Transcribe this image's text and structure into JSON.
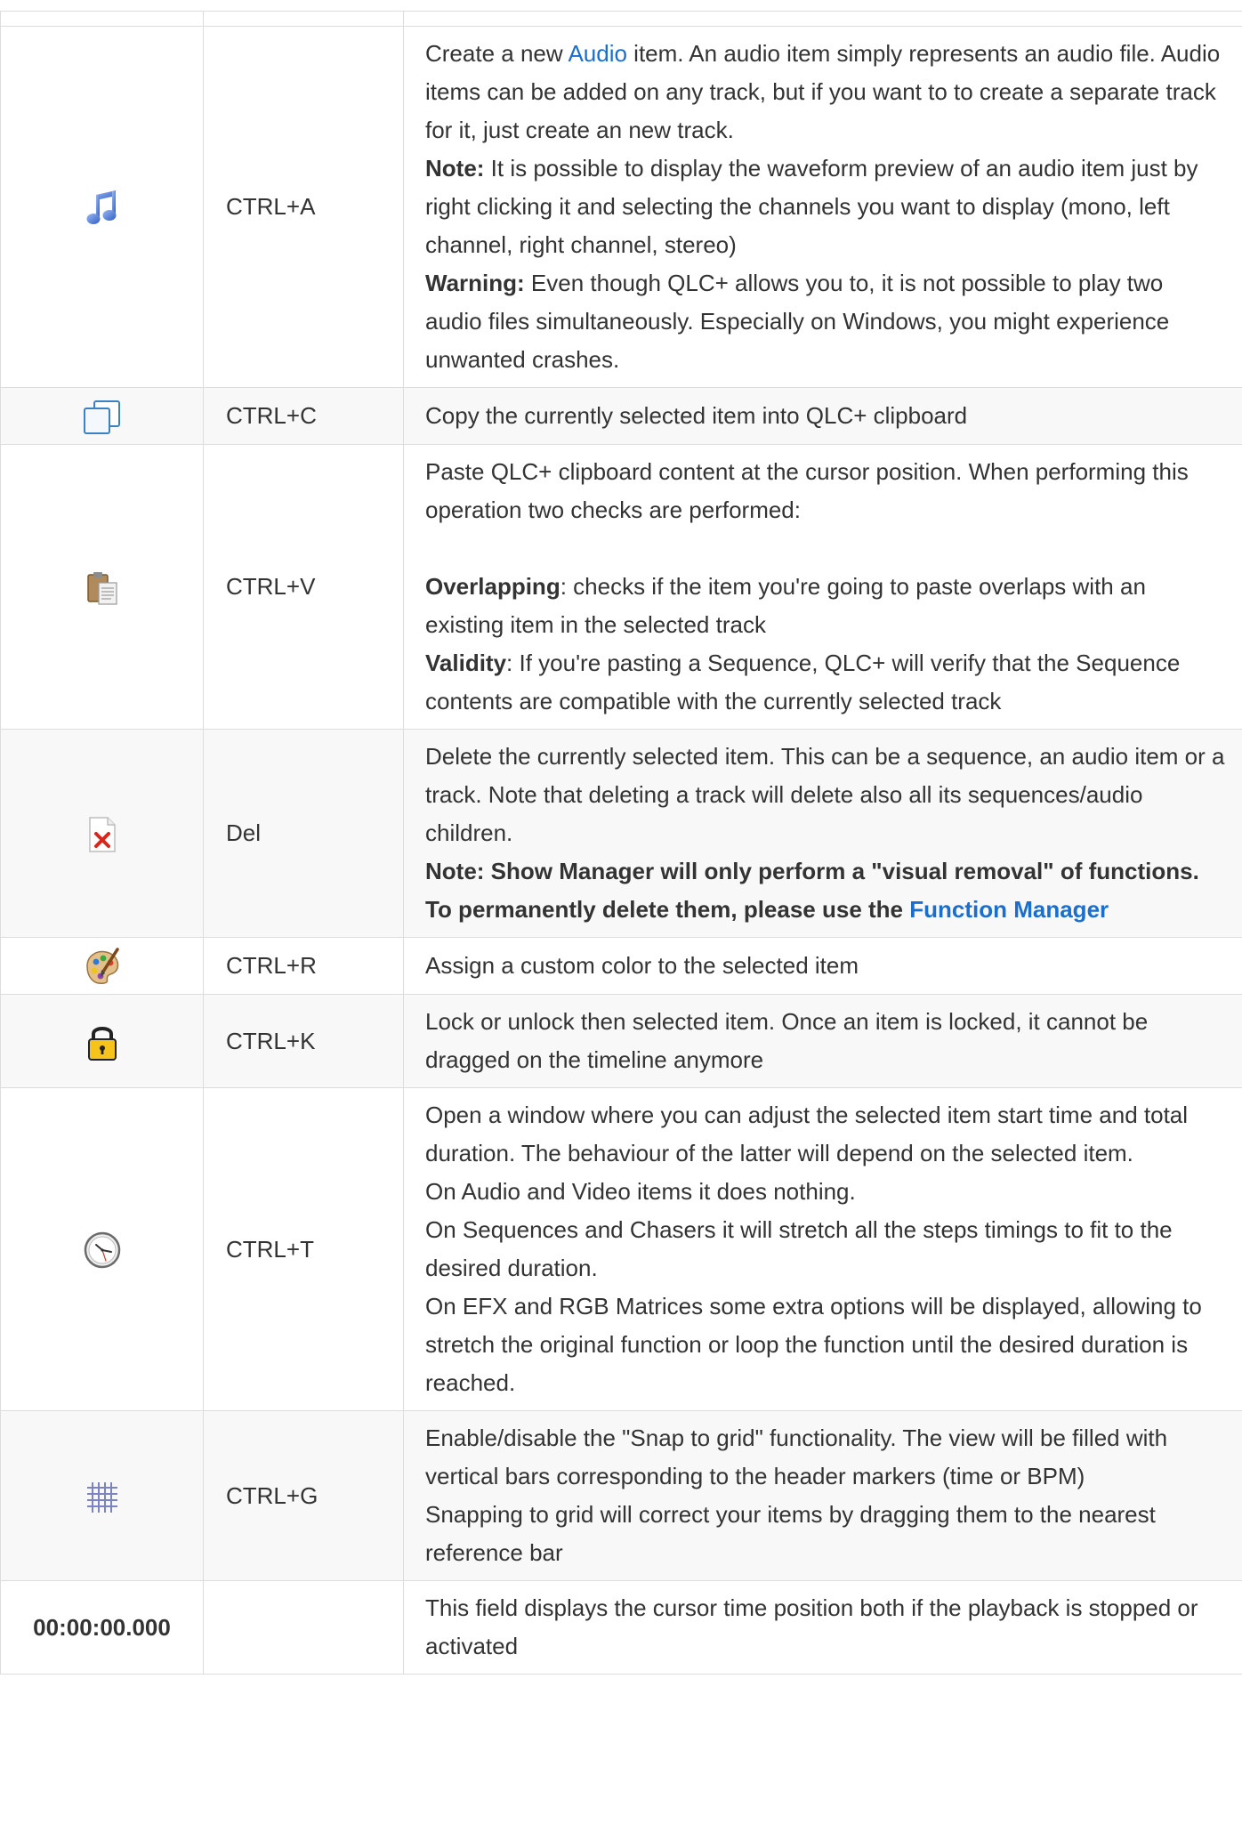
{
  "rows": [
    {
      "icon": "",
      "key": "",
      "desc": ""
    },
    {
      "icon": "music-note-icon",
      "key": "CTRL+A",
      "desc": {
        "p1_pre": "Create a new ",
        "p1_link": "Audio",
        "p1_post": " item. An audio item simply represents an audio file. Audio items can be added on any track, but if you want to to create a separate track for it, just create an new track.",
        "note_label": "Note:",
        "note_text": " It is possible to display the waveform preview of an audio item just by right clicking it and selecting the channels you want to display (mono, left channel, right channel, stereo)",
        "warning_label": "Warning:",
        "warning_text": " Even though QLC+ allows you to, it is not possible to play two audio files simultaneously. Especially on Windows, you might experience unwanted crashes."
      }
    },
    {
      "icon": "copy-icon",
      "key": "CTRL+C",
      "desc": "Copy the currently selected item into QLC+ clipboard"
    },
    {
      "icon": "paste-icon",
      "key": "CTRL+V",
      "desc": {
        "intro": "Paste QLC+ clipboard content at the cursor position. When performing this operation two checks are performed:",
        "overlap_label": "Overlapping",
        "overlap_text": ": checks if the item you're going to paste overlaps with an existing item in the selected track",
        "validity_label": "Validity",
        "validity_text": ": If you're pasting a Sequence, QLC+ will verify that the Sequence contents are compatible with the currently selected track"
      }
    },
    {
      "icon": "delete-icon",
      "key": "Del",
      "desc": {
        "text": "Delete the currently selected item. This can be a sequence, an audio item or a track. Note that deleting a track will delete also all its sequences/audio children.",
        "note_bold": "Note: Show Manager will only perform a \"visual removal\" of functions. To permanently delete them, please use the ",
        "link": "Function Manager"
      }
    },
    {
      "icon": "color-palette-icon",
      "key": "CTRL+R",
      "desc": "Assign a custom color to the selected item"
    },
    {
      "icon": "lock-icon",
      "key": "CTRL+K",
      "desc": "Lock or unlock then selected item. Once an item is locked, it cannot be dragged on the timeline anymore"
    },
    {
      "icon": "clock-icon",
      "key": "CTRL+T",
      "desc": {
        "p1": "Open a window where you can adjust the selected item start time and total duration. The behaviour of the latter will depend on the selected item.",
        "p2": "On Audio and Video items it does nothing.",
        "p3": "On Sequences and Chasers it will stretch all the steps timings to fit to the desired duration.",
        "p4": "On EFX and RGB Matrices some extra options will be displayed, allowing to stretch the original function or loop the function until the desired duration is reached."
      }
    },
    {
      "icon": "grid-icon",
      "key": "CTRL+G",
      "desc": {
        "p1": "Enable/disable the \"Snap to grid\" functionality. The view will be filled with vertical bars corresponding to the header markers (time or BPM)",
        "p2": "Snapping to grid will correct your items by dragging them to the nearest reference bar"
      }
    },
    {
      "time": "00:00:00.000",
      "key": "",
      "desc": "This field displays the cursor time position both if the playback is stopped or activated"
    }
  ],
  "colors": {
    "link": "#1a6fce",
    "border": "#dddddd",
    "row_alt": "#f8f8f8",
    "text": "#333333"
  }
}
